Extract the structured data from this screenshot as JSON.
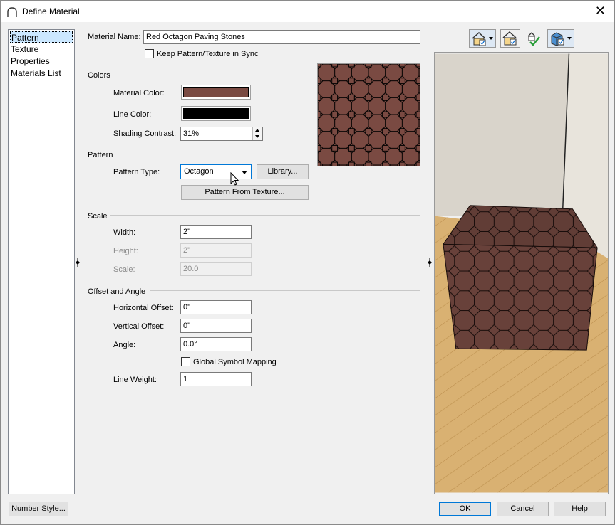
{
  "window": {
    "title": "Define Material"
  },
  "sidebar": {
    "items": [
      {
        "label": "Pattern",
        "selected": true
      },
      {
        "label": "Texture"
      },
      {
        "label": "Properties"
      },
      {
        "label": "Materials List"
      }
    ]
  },
  "material_name": {
    "label": "Material Name:",
    "value": "Red Octagon Paving Stones"
  },
  "keep_sync": {
    "label": "Keep Pattern/Texture in Sync",
    "checked": false
  },
  "colors": {
    "group_label": "Colors",
    "material_color_label": "Material Color:",
    "material_color": "#7a4a42",
    "line_color_label": "Line Color:",
    "line_color": "#000000",
    "shading_label": "Shading Contrast:",
    "shading_value": "31%"
  },
  "pattern": {
    "group_label": "Pattern",
    "type_label": "Pattern Type:",
    "type_value": "Octagon",
    "library_button": "Library...",
    "from_texture_button": "Pattern From Texture..."
  },
  "scale": {
    "group_label": "Scale",
    "width_label": "Width:",
    "width_value": "2\"",
    "height_label": "Height:",
    "height_value": "2\"",
    "scale_label": "Scale:",
    "scale_value": "20.0"
  },
  "offset": {
    "group_label": "Offset and Angle",
    "h_label": "Horizontal Offset:",
    "h_value": "0\"",
    "v_label": "Vertical Offset:",
    "v_value": "0\"",
    "angle_label": "Angle:",
    "angle_value": "0.0°",
    "global_label": "Global Symbol Mapping",
    "global_checked": false,
    "line_weight_label": "Line Weight:",
    "line_weight_value": "1"
  },
  "footer": {
    "number_style": "Number Style...",
    "ok": "OK",
    "cancel": "Cancel",
    "help": "Help"
  },
  "toolbar": {
    "icons": [
      "house-view-dropdown-icon",
      "house-check-icon",
      "check-mark-icon",
      "cube-view-dropdown-icon"
    ]
  },
  "colors_scene": {
    "floor": "#d7ae6e",
    "wall": "#e2ddd3",
    "accent": "#0078d7"
  }
}
